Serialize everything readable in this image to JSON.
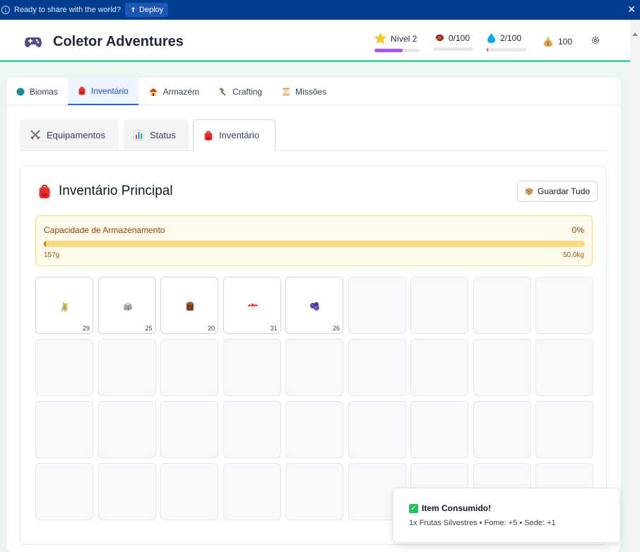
{
  "banner": {
    "message": "Ready to share with the world?",
    "deploy_label": "Deploy",
    "info_icon": "info-icon",
    "close_icon": "close-icon"
  },
  "header": {
    "title": "Coletor Adventures",
    "logo_icon": "gamepad-icon",
    "stats": [
      {
        "name": "level",
        "icon": "star-icon",
        "text": "Nível 2",
        "progress": 0.62,
        "color": "#a855f7"
      },
      {
        "name": "hunger",
        "icon": "meat-icon",
        "text": "0/100",
        "progress": 0.0,
        "color": "#ef4444"
      },
      {
        "name": "thirst",
        "icon": "water-drop-icon",
        "text": "2/100",
        "progress": 0.02,
        "color": "#ef4444"
      },
      {
        "name": "money",
        "icon": "money-bag-icon",
        "text": "100"
      }
    ],
    "settings_icon": "gear-icon"
  },
  "tabs": [
    {
      "label": "Biomas",
      "icon": "globe-icon",
      "active": false
    },
    {
      "label": "Inventário",
      "icon": "backpack-icon",
      "active": true
    },
    {
      "label": "Armazém",
      "icon": "house-icon",
      "active": false
    },
    {
      "label": "Crafting",
      "icon": "hammer-icon",
      "active": false
    },
    {
      "label": "Missões",
      "icon": "scroll-icon",
      "active": false
    }
  ],
  "subtabs": [
    {
      "label": "Equipamentos",
      "icon": "crossed-swords-icon",
      "active": false
    },
    {
      "label": "Status",
      "icon": "bar-chart-icon",
      "active": false
    },
    {
      "label": "Inventário",
      "icon": "backpack-icon",
      "active": true
    }
  ],
  "inventory": {
    "title": "Inventário Principal",
    "title_icon": "backpack-icon",
    "store_all_label": "Guardar Tudo",
    "store_all_icon": "box-icon",
    "capacity": {
      "label": "Capacidade de Armazenamento",
      "percent_text": "0%",
      "fraction": 0.003,
      "current": "157g",
      "max": "50.0kg"
    },
    "slots": [
      {
        "item": "wheat-icon",
        "qty": "29"
      },
      {
        "item": "rock-icon",
        "qty": "25"
      },
      {
        "item": "wood-log-icon",
        "qty": "20"
      },
      {
        "item": "mushroom-icon",
        "qty": "31"
      },
      {
        "item": "berries-icon",
        "qty": "26"
      },
      {},
      {},
      {},
      {},
      {},
      {},
      {},
      {},
      {},
      {},
      {},
      {},
      {},
      {},
      {},
      {},
      {},
      {},
      {},
      {},
      {},
      {},
      {},
      {},
      {},
      {},
      {},
      {},
      {},
      {},
      {}
    ]
  },
  "toast": {
    "title": "Item Consumido!",
    "message": "1x Frutas Silvestres • Fome: +5 • Sede: +1",
    "icon": "check-icon"
  }
}
